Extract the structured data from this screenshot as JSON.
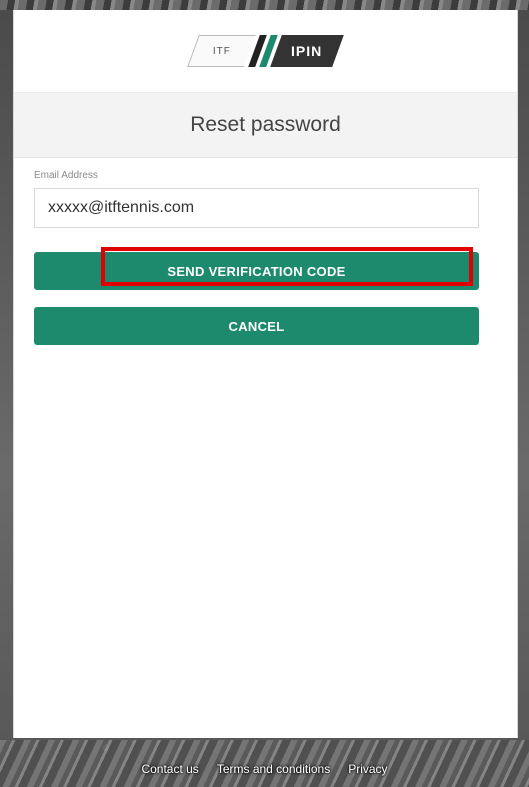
{
  "logo": {
    "badge_text": "ITF",
    "brand_text": "IPIN"
  },
  "page": {
    "title": "Reset password"
  },
  "form": {
    "email_label": "Email Address",
    "email_value": "xxxxx@itftennis.com"
  },
  "buttons": {
    "send_code": "SEND VERIFICATION CODE",
    "cancel": "CANCEL"
  },
  "footer": {
    "links": [
      "Contact us",
      "Terms and conditions",
      "Privacy"
    ]
  },
  "colors": {
    "primary": "#1e8a6d",
    "highlight": "#e00000"
  }
}
